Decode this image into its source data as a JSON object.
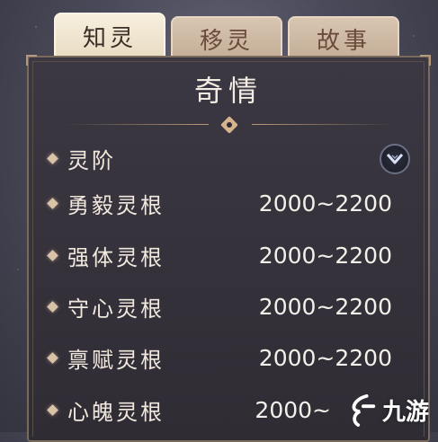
{
  "tabs": [
    {
      "label": "知灵",
      "active": true
    },
    {
      "label": "移灵",
      "active": false
    },
    {
      "label": "故事",
      "active": false
    }
  ],
  "panel": {
    "title": "奇情",
    "section_label": "灵阶",
    "toggle_icon": "chevron-down-icon",
    "rows": [
      {
        "label": "勇毅灵根",
        "value": "2000~2200"
      },
      {
        "label": "强体灵根",
        "value": "2000~2200"
      },
      {
        "label": "守心灵根",
        "value": "2000~2200"
      },
      {
        "label": "禀赋灵根",
        "value": "2000~2200"
      },
      {
        "label": "心魄灵根",
        "value": "2000~"
      }
    ]
  },
  "watermark": {
    "text": "九游"
  },
  "colors": {
    "accent": "#d5b48e",
    "panel": "#36323c",
    "tab_active": "#f3e8d4"
  }
}
